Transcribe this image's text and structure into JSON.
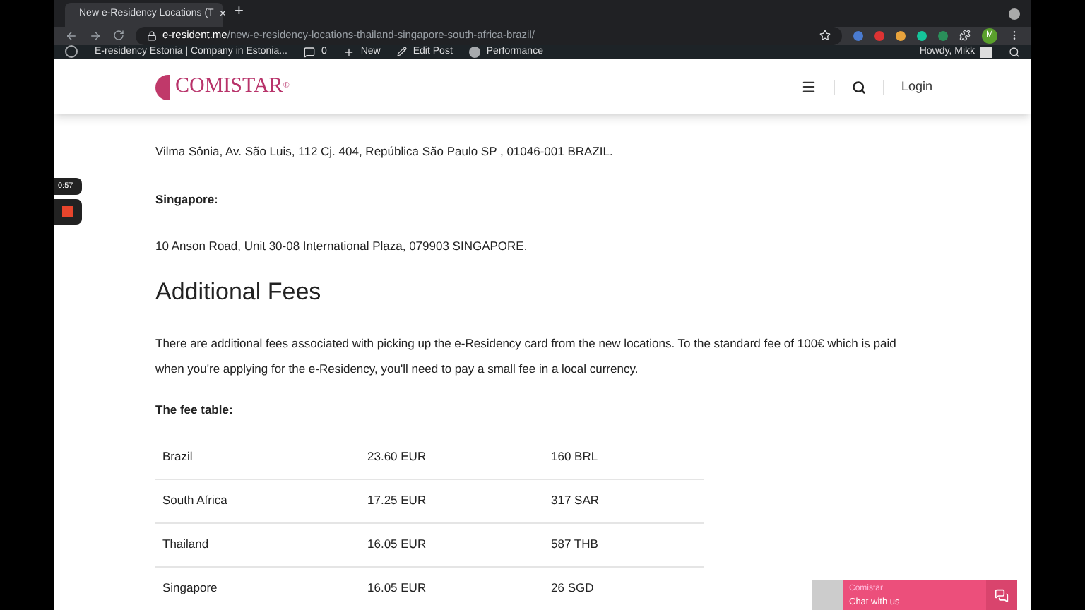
{
  "browser": {
    "tab": {
      "title": "New e-Residency Locations (T",
      "close": "×"
    },
    "new_tab": "+",
    "url": {
      "host": "e-resident.me",
      "path": "/new-e-residency-locations-thailand-singapore-south-africa-brazil/"
    },
    "profile": "M"
  },
  "admin_bar": {
    "site": "E-residency Estonia | Company in Estonia...",
    "comments": "0",
    "new": "New",
    "edit": "Edit Post",
    "performance": "Performance",
    "greeting": "Howdy, Mikk"
  },
  "header": {
    "logo": "COMISTAR",
    "logo_mark": "®",
    "login": "Login"
  },
  "recorder": {
    "time": "0:57"
  },
  "content": {
    "brazil_address": "Vilma Sônia, Av. São Luis, 112 Cj. 404, República São Paulo SP , 01046-001 BRAZIL.",
    "singapore_label": "Singapore:",
    "singapore_address": "10 Anson Road, Unit 30-08 International Plaza, 079903 SINGAPORE.",
    "heading": "Additional Fees",
    "paragraph": "There are additional fees associated with picking up the e-Residency card from the new locations. To the standard fee of 100€ which is paid when you're applying for the e-Residency, you'll need to pay a small fee in a local currency.",
    "table_label": "The fee table:",
    "rows": [
      {
        "country": "Brazil",
        "eur": "23.60 EUR",
        "local": "160 BRL"
      },
      {
        "country": "South Africa",
        "eur": "17.25 EUR",
        "local": "317 SAR"
      },
      {
        "country": "Thailand",
        "eur": "16.05 EUR",
        "local": "587 THB"
      },
      {
        "country": "Singapore",
        "eur": "16.05 EUR",
        "local": "26 SGD"
      }
    ]
  },
  "chat": {
    "name": "Comistar",
    "prompt": "Chat with us"
  }
}
